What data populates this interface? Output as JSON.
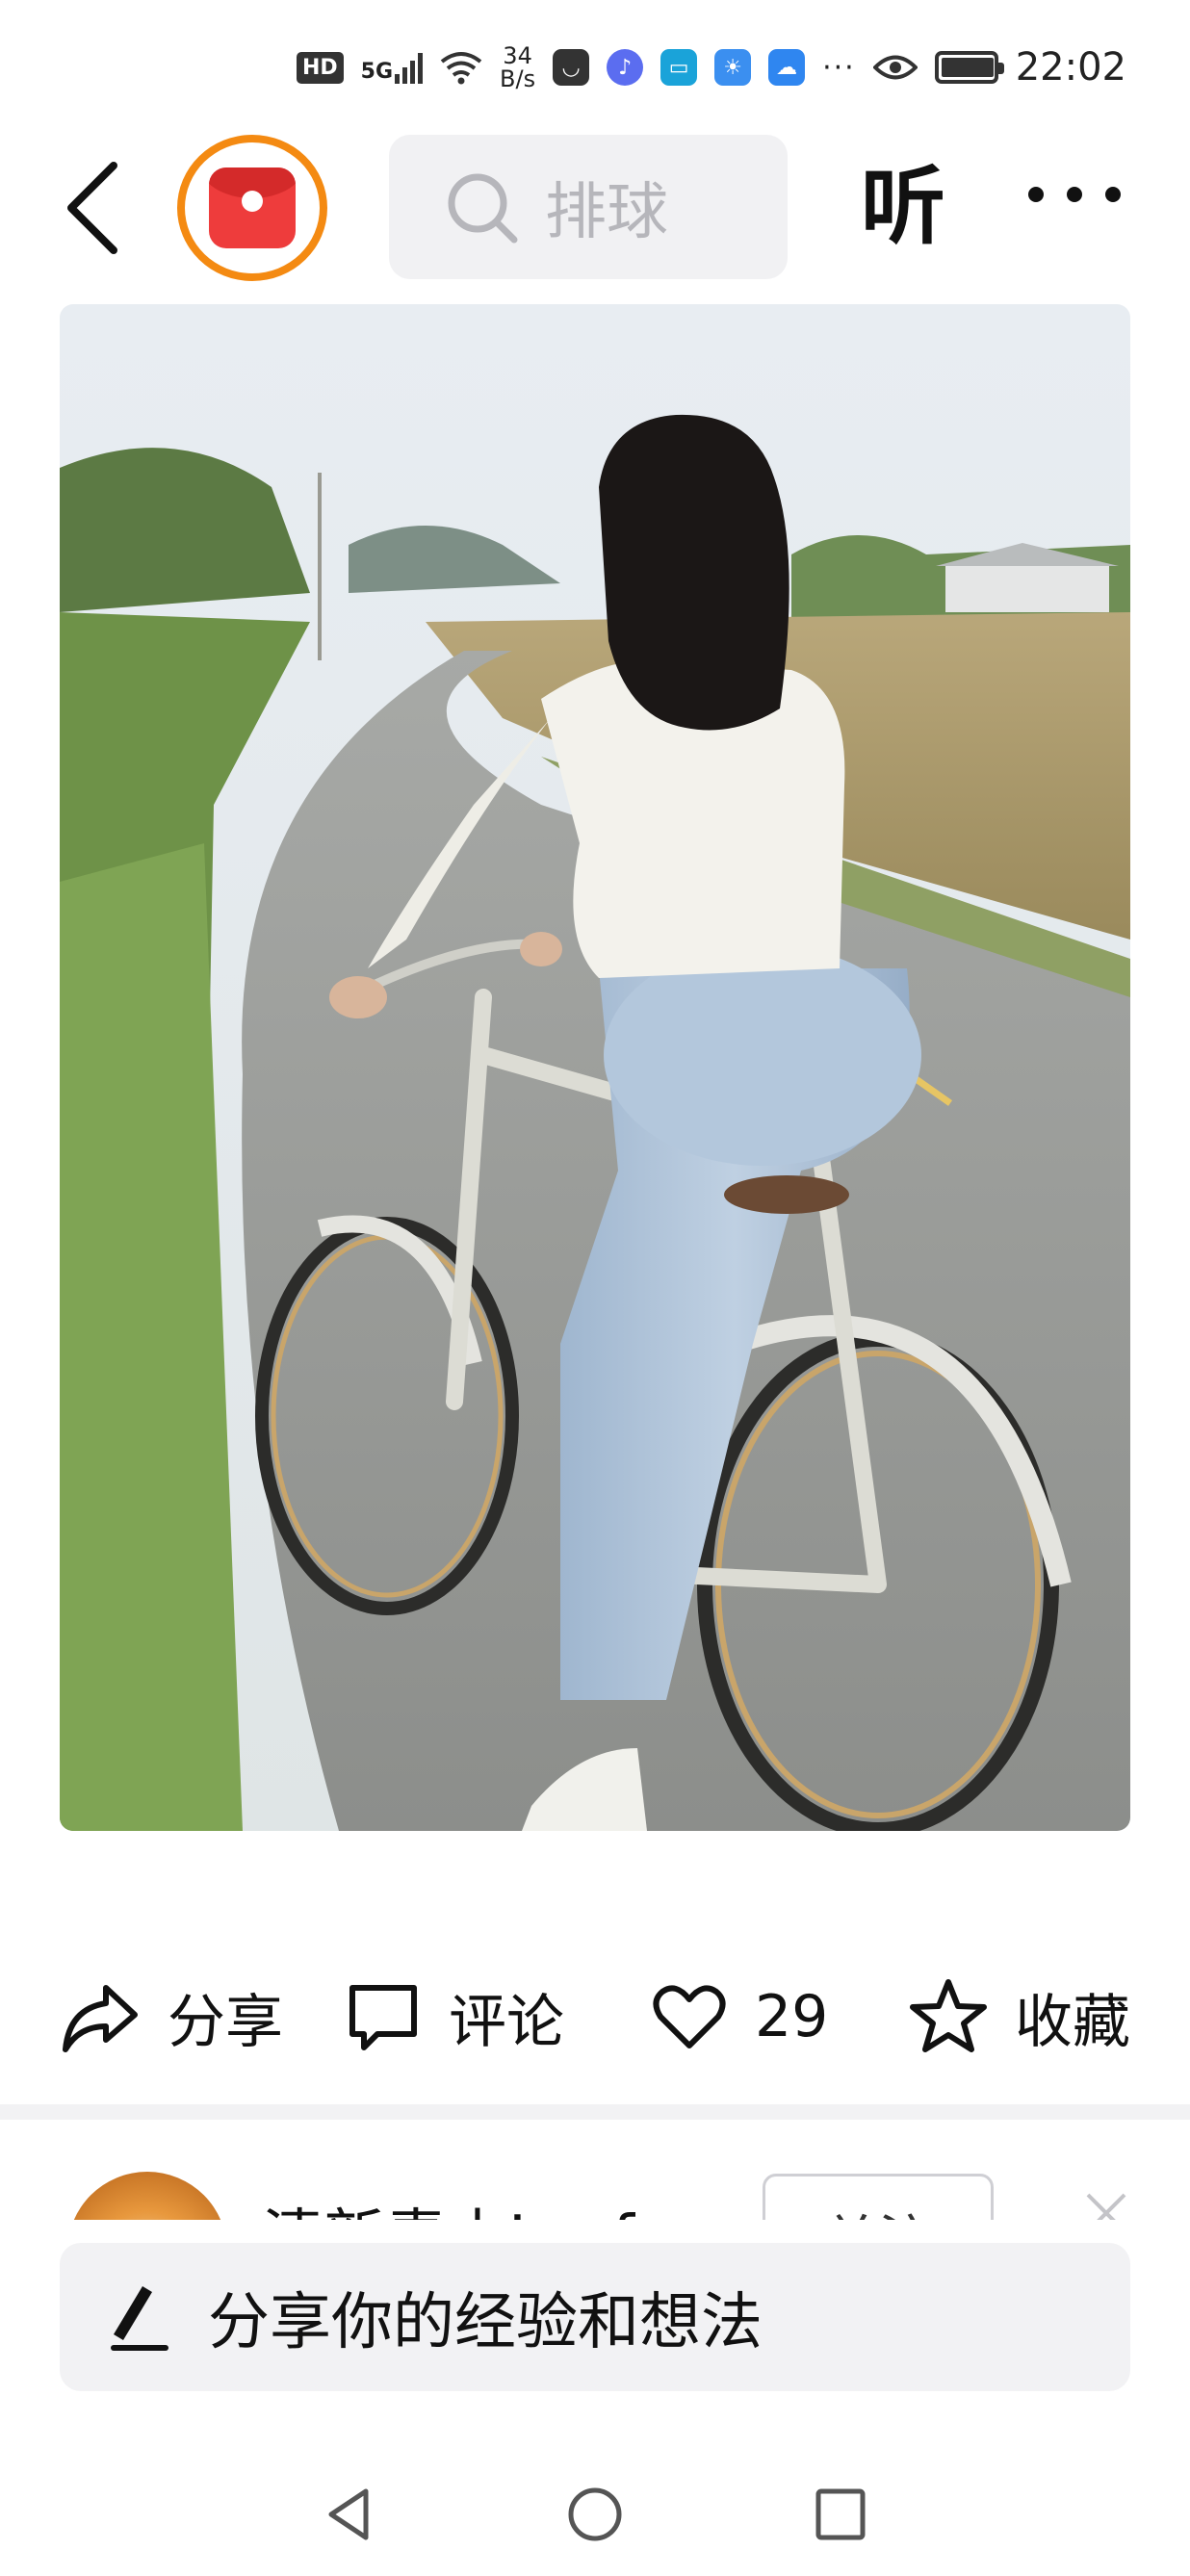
{
  "status_bar": {
    "hd": "HD",
    "network": "5G",
    "speed_value": "34",
    "speed_unit": "B/s",
    "overflow": "···",
    "time": "22:02"
  },
  "header": {
    "search_placeholder": "排球"
  },
  "header_listen": "听",
  "actions": {
    "share_label": "分享",
    "comment_label": "评论",
    "like_count": "29",
    "favorite_label": "收藏"
  },
  "author": {
    "name": "清新青山Lynf",
    "follow_label": "关注"
  },
  "comment": {
    "placeholder": "分享你的经验和想法"
  },
  "colors": {
    "brand_orange": "#f48a12",
    "brand_red": "#ee3c3c",
    "search_bg": "#f1f1f3",
    "placeholder_gray": "#b6b6bb"
  }
}
